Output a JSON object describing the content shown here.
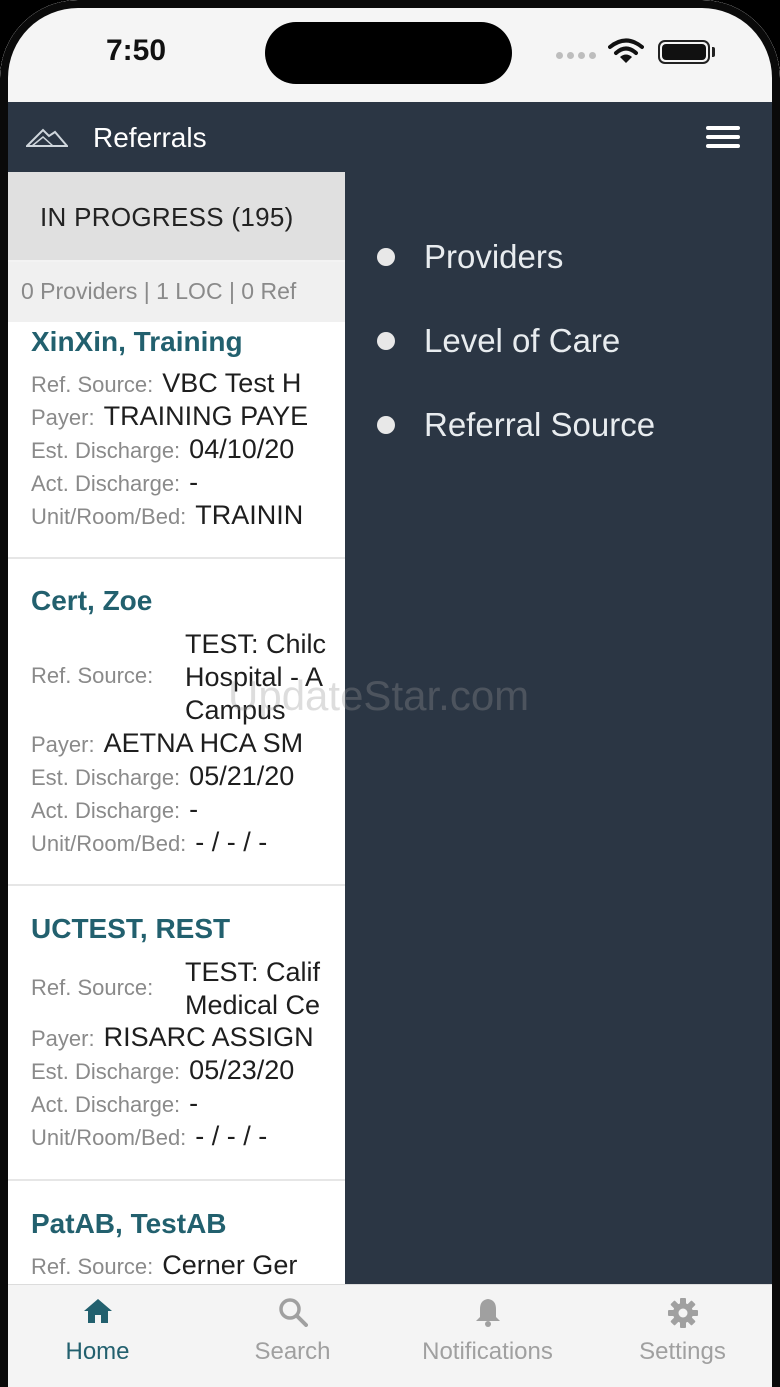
{
  "status_bar": {
    "time": "7:50"
  },
  "header": {
    "title": "Referrals"
  },
  "tabs": {
    "in_progress": "IN PROGRESS (195)"
  },
  "filter_summary": "0 Providers | 1 LOC | 0 Ref",
  "labels": {
    "ref_source": "Ref. Source:",
    "payer": "Payer:",
    "est_discharge": "Est. Discharge:",
    "act_discharge": "Act. Discharge:",
    "unit_room_bed": "Unit/Room/Bed:"
  },
  "patients": [
    {
      "name": "XinXin, Training",
      "ref_source": "VBC Test H",
      "payer": "TRAINING PAYE",
      "est_discharge": "04/10/20",
      "act_discharge": "-",
      "unit_room_bed": "TRAININ"
    },
    {
      "name": "Cert, Zoe",
      "ref_source_lines": [
        "TEST: Chilc",
        "Hospital - A",
        "Campus"
      ],
      "payer": "AETNA HCA SM",
      "est_discharge": "05/21/20",
      "act_discharge": "-",
      "unit_room_bed": "- / - / -"
    },
    {
      "name": "UCTEST, REST",
      "ref_source_lines": [
        "TEST: Calif",
        "Medical Ce"
      ],
      "payer": "RISARC ASSIGN",
      "est_discharge": "05/23/20",
      "act_discharge": "-",
      "unit_room_bed": "- / - / -"
    },
    {
      "name": "PatAB, TestAB",
      "ref_source": "Cerner Ger"
    }
  ],
  "watermark": "UpdateStar.com",
  "side_menu": {
    "items": [
      {
        "label": "Providers"
      },
      {
        "label": "Level of Care"
      },
      {
        "label": "Referral Source"
      }
    ]
  },
  "bottom_nav": {
    "items": [
      {
        "label": "Home",
        "icon": "home-icon",
        "active": true
      },
      {
        "label": "Search",
        "icon": "search-icon"
      },
      {
        "label": "Notifications",
        "icon": "bell-icon"
      },
      {
        "label": "Settings",
        "icon": "gear-icon"
      }
    ]
  },
  "colors": {
    "header_bg": "#2b3644",
    "accent": "#22606e"
  }
}
